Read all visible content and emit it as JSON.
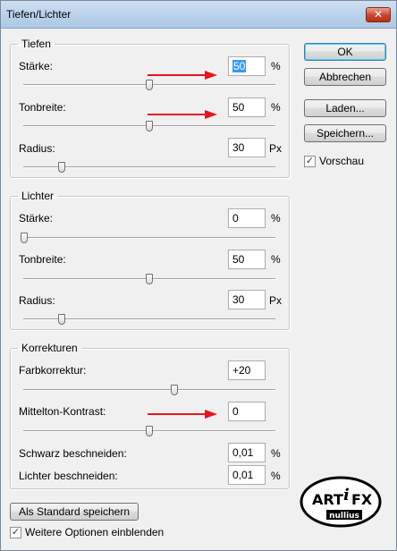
{
  "window": {
    "title": "Tiefen/Lichter",
    "close_glyph": "✕"
  },
  "tiefen": {
    "legend": "Tiefen",
    "staerke": {
      "label": "Stärke:",
      "value": "50",
      "unit": "%",
      "slider_fraction": 0.5
    },
    "tonbreite": {
      "label": "Tonbreite:",
      "value": "50",
      "unit": "%",
      "slider_fraction": 0.5
    },
    "radius": {
      "label": "Radius:",
      "value": "30",
      "unit": "Px",
      "slider_fraction": 0.15
    }
  },
  "lichter": {
    "legend": "Lichter",
    "staerke": {
      "label": "Stärke:",
      "value": "0",
      "unit": "%",
      "slider_fraction": 0.0
    },
    "tonbreite": {
      "label": "Tonbreite:",
      "value": "50",
      "unit": "%",
      "slider_fraction": 0.5
    },
    "radius": {
      "label": "Radius:",
      "value": "30",
      "unit": "Px",
      "slider_fraction": 0.15
    }
  },
  "korrekturen": {
    "legend": "Korrekturen",
    "farbkorrektur": {
      "label": "Farbkorrektur:",
      "value": "+20",
      "slider_fraction": 0.6
    },
    "mittelton": {
      "label": "Mittelton-Kontrast:",
      "value": "0",
      "slider_fraction": 0.5
    },
    "schwarz": {
      "label": "Schwarz beschneiden:",
      "value": "0,01",
      "unit": "%"
    },
    "lichter": {
      "label": "Lichter beschneiden:",
      "value": "0,01",
      "unit": "%"
    }
  },
  "buttons": {
    "ok": "OK",
    "abbrechen": "Abbrechen",
    "laden": "Laden...",
    "speichern": "Speichern...",
    "standard": "Als Standard speichern"
  },
  "vorschau": {
    "label": "Vorschau",
    "checked": true
  },
  "weitere": {
    "label": "Weitere Optionen einblenden",
    "checked": true
  },
  "logo": {
    "line1": "ART",
    "line2": "i",
    "line3": "FX",
    "sub": "nullius"
  },
  "colors": {
    "arrow": "#e8141e",
    "selection": "#3399ff"
  }
}
